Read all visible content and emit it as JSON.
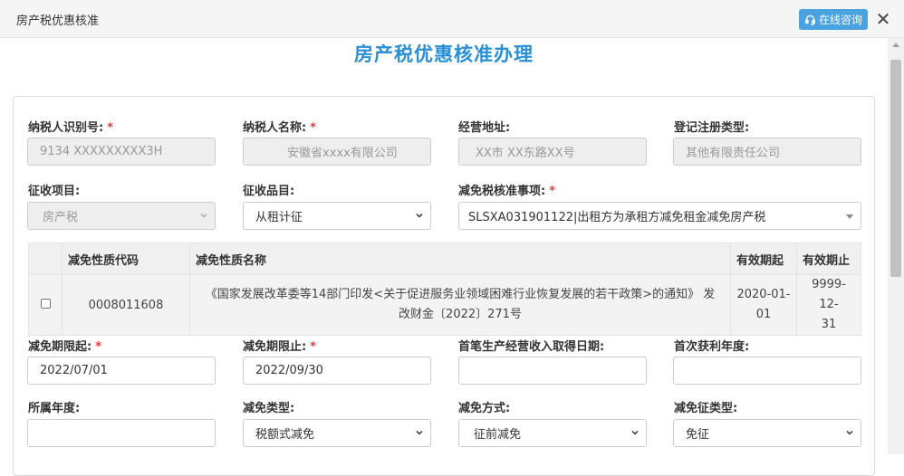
{
  "window": {
    "title": "房产税优惠核准",
    "consult_label": "在线咨询"
  },
  "page": {
    "title": "房产税优惠核准办理"
  },
  "form": {
    "row1": [
      {
        "label": "纳税人识别号:",
        "required": true,
        "value": "9134 XXXXXXXXX3H",
        "disabled": true
      },
      {
        "label": "纳税人名称:",
        "required": true,
        "value": "安徽省xxxx有限公司",
        "disabled": true
      },
      {
        "label": "经营地址:",
        "required": false,
        "value": "XX市 XX东路XX号",
        "disabled": true
      },
      {
        "label": "登记注册类型:",
        "required": false,
        "value": "其他有限责任公司",
        "disabled": true
      }
    ],
    "row2": [
      {
        "label": "征收项目:",
        "required": false,
        "value": "房产税",
        "disabled": true
      },
      {
        "label": "征收品目:",
        "required": false,
        "value": "从租计征",
        "disabled": false
      },
      {
        "label": "减免税核准事项:",
        "required": true,
        "value": "SLSXA031901122|出租方为承租方减免租金减免房产税",
        "disabled": false
      }
    ],
    "row3": [
      {
        "label": "减免期限起:",
        "required": true,
        "value": "2022/07/01"
      },
      {
        "label": "减免期限止:",
        "required": true,
        "value": "2022/09/30"
      },
      {
        "label": "首笔生产经营收入取得日期:",
        "required": false,
        "value": ""
      },
      {
        "label": "首次获利年度:",
        "required": false,
        "value": ""
      }
    ],
    "row4": [
      {
        "label": "所属年度:",
        "required": false,
        "value": ""
      },
      {
        "label": "减免类型:",
        "required": false,
        "value": "税额式减免"
      },
      {
        "label": "减免方式:",
        "required": false,
        "value": "征前减免"
      },
      {
        "label": "减免征类型:",
        "required": false,
        "value": "免征"
      }
    ]
  },
  "table": {
    "headers": [
      "",
      "减免性质代码",
      "减免性质名称",
      "有效期起",
      "有效期止"
    ],
    "rows": [
      {
        "code": "0008011608",
        "name_line1": "《国家发展改革委等14部门印发<关于促进服务业领域困难行业恢复发展的若干政策>的通知》 发",
        "name_line2": "改财金〔2022〕271号",
        "start_line1": "2020-01-",
        "start_line2": "01",
        "end_line1": "9999-12-",
        "end_line2": "31"
      }
    ]
  },
  "colors": {
    "accent": "#2a8fd4",
    "button": "#4aa3e0",
    "required": "#e4393c"
  }
}
